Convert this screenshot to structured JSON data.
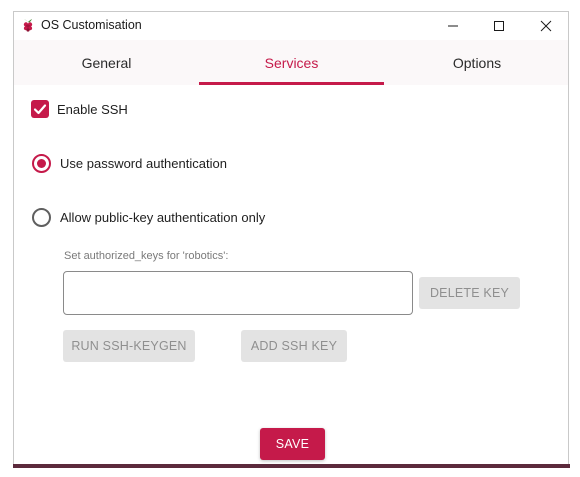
{
  "window": {
    "title": "OS Customisation",
    "app_icon": "raspberry-icon",
    "controls": {
      "minimize": "minimize-icon",
      "maximize": "maximize-icon",
      "close": "close-icon"
    }
  },
  "tabs": [
    {
      "label": "General",
      "selected": false
    },
    {
      "label": "Services",
      "selected": true
    },
    {
      "label": "Options",
      "selected": false
    }
  ],
  "ssh": {
    "enable_label": "Enable SSH",
    "enable_checked": true,
    "password_auth_label": "Use password authentication",
    "password_auth_selected": true,
    "pubkey_auth_label": "Allow public-key authentication only",
    "pubkey_auth_selected": false,
    "authorized_keys_label": "Set authorized_keys for 'robotics':",
    "authorized_keys_value": "",
    "delete_key_label": "DELETE KEY",
    "run_keygen_label": "RUN SSH-KEYGEN",
    "add_key_label": "ADD SSH KEY"
  },
  "footer": {
    "save_label": "SAVE"
  },
  "colors": {
    "accent": "#c51a4a",
    "disabled_button_bg": "#e3e3e3",
    "disabled_button_text": "#8f8f8f",
    "tab_bar_bg": "#fbf8f9",
    "window_bottom_edge": "#5c2a3c"
  }
}
